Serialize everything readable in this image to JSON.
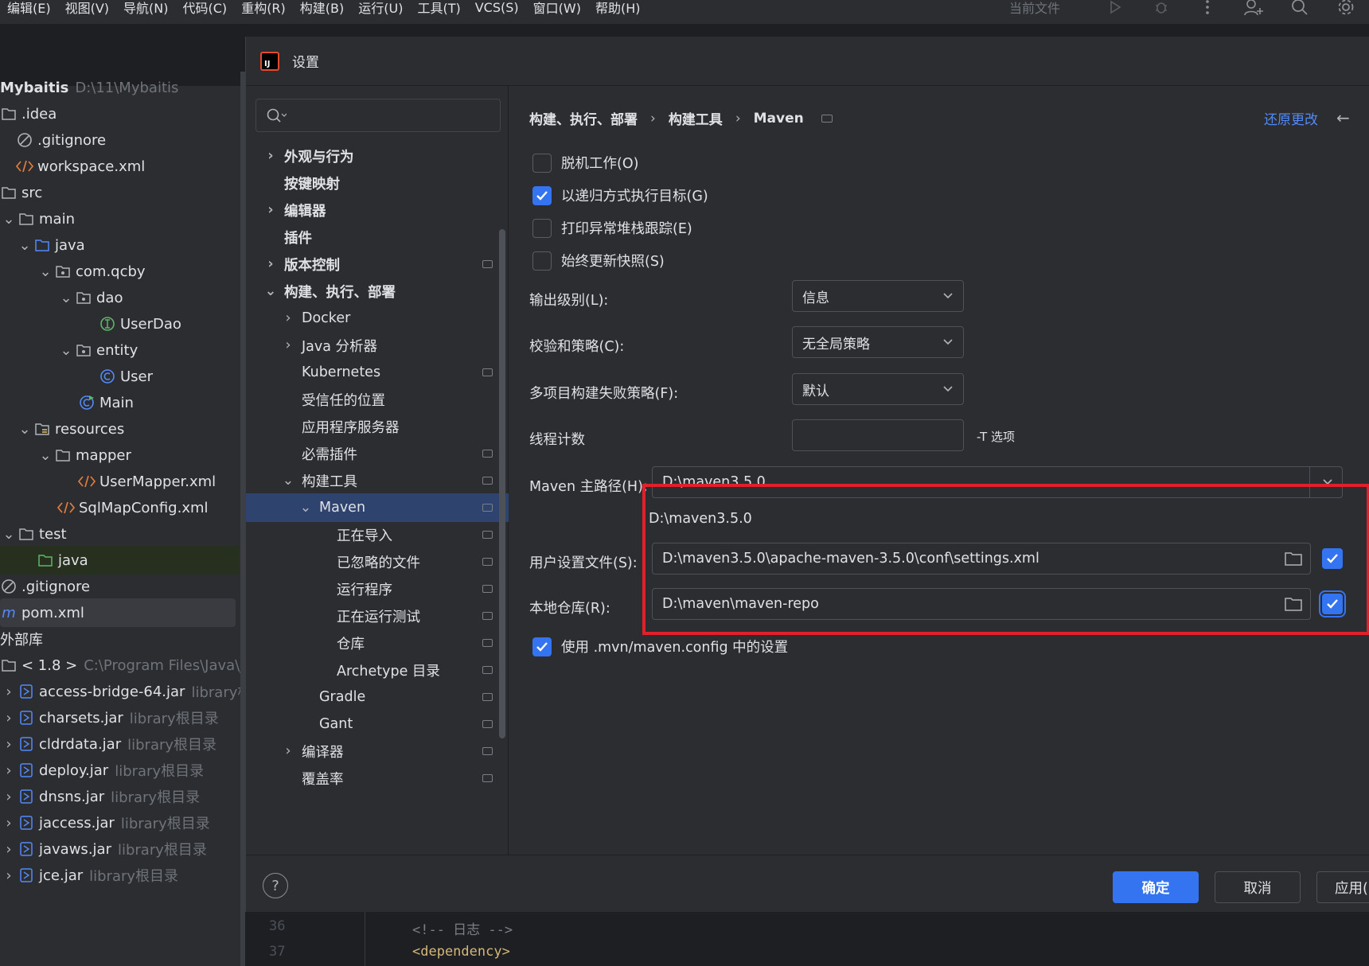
{
  "menubar": {
    "items": [
      "编辑(E)",
      "视图(V)",
      "导航(N)",
      "代码(C)",
      "重构(R)",
      "构建(B)",
      "运行(U)",
      "工具(T)",
      "VCS(S)",
      "窗口(W)",
      "帮助(H)"
    ],
    "current_file": "当前文件"
  },
  "project": {
    "rows": [
      {
        "label": "Mybaitis",
        "extra": "D:\\11\\Mybaitis",
        "kind": "root"
      },
      {
        "label": ".idea",
        "kind": "folder"
      },
      {
        "label": ".gitignore",
        "kind": "ignore"
      },
      {
        "label": "workspace.xml",
        "kind": "xml"
      },
      {
        "label": "src",
        "kind": "folder"
      },
      {
        "label": "main",
        "kind": "folder"
      },
      {
        "label": "java",
        "kind": "src-folder"
      },
      {
        "label": "com.qcby",
        "kind": "package"
      },
      {
        "label": "dao",
        "kind": "package"
      },
      {
        "label": "UserDao",
        "kind": "interface"
      },
      {
        "label": "entity",
        "kind": "package"
      },
      {
        "label": "User",
        "kind": "class"
      },
      {
        "label": "Main",
        "kind": "main-class"
      },
      {
        "label": "resources",
        "kind": "res-folder"
      },
      {
        "label": "mapper",
        "kind": "folder"
      },
      {
        "label": "UserMapper.xml",
        "kind": "xml"
      },
      {
        "label": "SqlMapConfig.xml",
        "kind": "xml"
      },
      {
        "label": "test",
        "kind": "folder"
      },
      {
        "label": "java",
        "kind": "test-folder"
      },
      {
        "label": ".gitignore",
        "kind": "ignore"
      },
      {
        "label": "pom.xml",
        "kind": "maven"
      },
      {
        "label": "外部库",
        "kind": "plain"
      },
      {
        "label": "< 1.8 >",
        "extra": "C:\\Program Files\\Java\\jdk",
        "kind": "jdk"
      },
      {
        "label": "access-bridge-64.jar",
        "extra": "library根",
        "kind": "jar"
      },
      {
        "label": "charsets.jar",
        "extra": "library根目录",
        "kind": "jar"
      },
      {
        "label": "cldrdata.jar",
        "extra": "library根目录",
        "kind": "jar"
      },
      {
        "label": "deploy.jar",
        "extra": "library根目录",
        "kind": "jar"
      },
      {
        "label": "dnsns.jar",
        "extra": "library根目录",
        "kind": "jar"
      },
      {
        "label": "jaccess.jar",
        "extra": "library根目录",
        "kind": "jar"
      },
      {
        "label": "javaws.jar",
        "extra": "library根目录",
        "kind": "jar"
      },
      {
        "label": "jce.jar",
        "extra": "library根目录",
        "kind": "jar"
      }
    ]
  },
  "dialog": {
    "title": "设置",
    "search_placeholder": "",
    "tree": [
      {
        "label": "外观与行为"
      },
      {
        "label": "按键映射"
      },
      {
        "label": "编辑器"
      },
      {
        "label": "插件"
      },
      {
        "label": "版本控制"
      },
      {
        "label": "构建、执行、部署"
      },
      {
        "label": "Docker"
      },
      {
        "label": "Java 分析器"
      },
      {
        "label": "Kubernetes"
      },
      {
        "label": "受信任的位置"
      },
      {
        "label": "应用程序服务器"
      },
      {
        "label": "必需插件"
      },
      {
        "label": "构建工具"
      },
      {
        "label": "Maven"
      },
      {
        "label": "正在导入"
      },
      {
        "label": "已忽略的文件"
      },
      {
        "label": "运行程序"
      },
      {
        "label": "正在运行测试"
      },
      {
        "label": "仓库"
      },
      {
        "label": "Archetype 目录"
      },
      {
        "label": "Gradle"
      },
      {
        "label": "Gant"
      },
      {
        "label": "编译器"
      },
      {
        "label": "覆盖率"
      }
    ],
    "breadcrumb": [
      "构建、执行、部署",
      "构建工具",
      "Maven"
    ],
    "revert_label": "还原更改",
    "checkboxes": [
      {
        "label": "脱机工作(O)",
        "checked": false
      },
      {
        "label": "以递归方式执行目标(G)",
        "checked": true
      },
      {
        "label": "打印异常堆栈跟踪(E)",
        "checked": false
      },
      {
        "label": "始终更新快照(S)",
        "checked": false
      }
    ],
    "output_level": {
      "label": "输出级别(L):",
      "value": "信息"
    },
    "checksum_policy": {
      "label": "校验和策略(C):",
      "value": "无全局策略"
    },
    "fail_policy": {
      "label": "多项目构建失败策略(F):",
      "value": "默认"
    },
    "threads": {
      "label": "线程计数",
      "value": "",
      "option": "-T 选项"
    },
    "maven_home": {
      "label": "Maven 主路径(H):",
      "value": "D:\\maven3.5.0",
      "hint": "D:\\maven3.5.0"
    },
    "user_settings": {
      "label": "用户设置文件(S):",
      "value": "D:\\maven3.5.0\\apache-maven-3.5.0\\conf\\settings.xml",
      "override": true
    },
    "local_repo": {
      "label": "本地仓库(R):",
      "value": "D:\\maven\\maven-repo",
      "override": true
    },
    "use_mvn_config": {
      "label": "使用 .mvn/maven.config 中的设置",
      "checked": true
    },
    "buttons": {
      "ok": "确定",
      "cancel": "取消",
      "apply": "应用("
    },
    "highlight_color": "#e0202a",
    "accent_color": "#3574f0"
  },
  "editor": {
    "lines": [
      {
        "num": "36",
        "code": "<!-- 日志 -->"
      },
      {
        "num": "37",
        "code": "<dependency>"
      }
    ]
  }
}
